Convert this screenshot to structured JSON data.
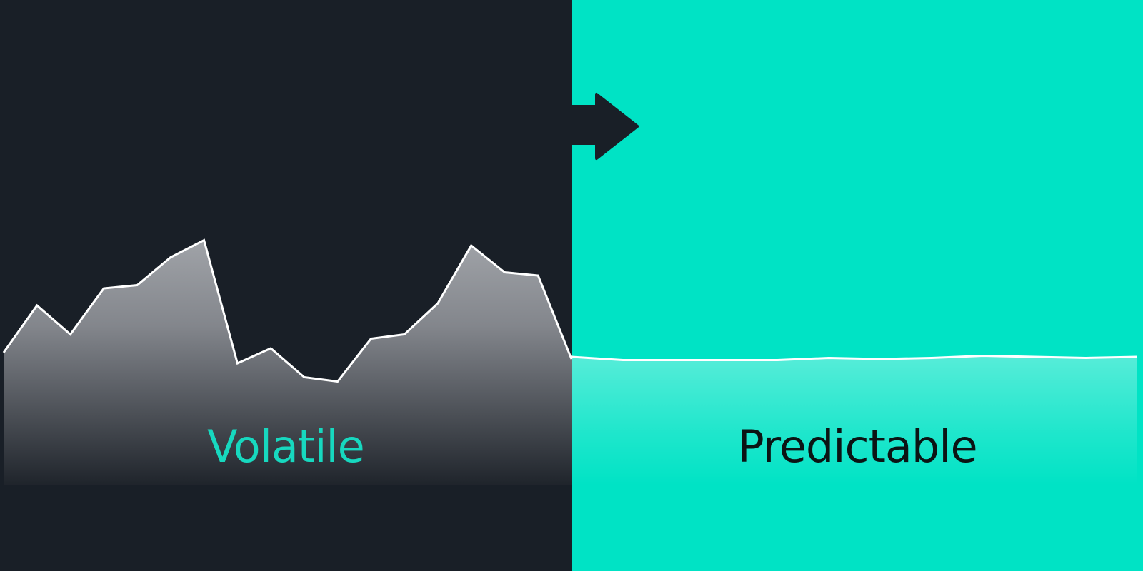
{
  "labels": {
    "left": "Volatile",
    "right": "Predictable"
  },
  "colors": {
    "dark_background": "#191f27",
    "accent": "#00e3c5",
    "volatile_text": "#17d8bf",
    "predictable_text": "#0b1414",
    "line": "#ffffff"
  },
  "icons": {
    "arrow": "arrow-right-icon"
  },
  "series": {
    "volatile": [
      4,
      48,
      21,
      64,
      67,
      93,
      109,
      -6,
      8,
      -19,
      -23,
      17,
      21,
      50,
      104,
      79,
      76,
      -2
    ],
    "predictable": [
      0,
      -3,
      -3,
      -3,
      -3,
      -1,
      -2,
      -1,
      1,
      0,
      -1,
      0
    ]
  }
}
